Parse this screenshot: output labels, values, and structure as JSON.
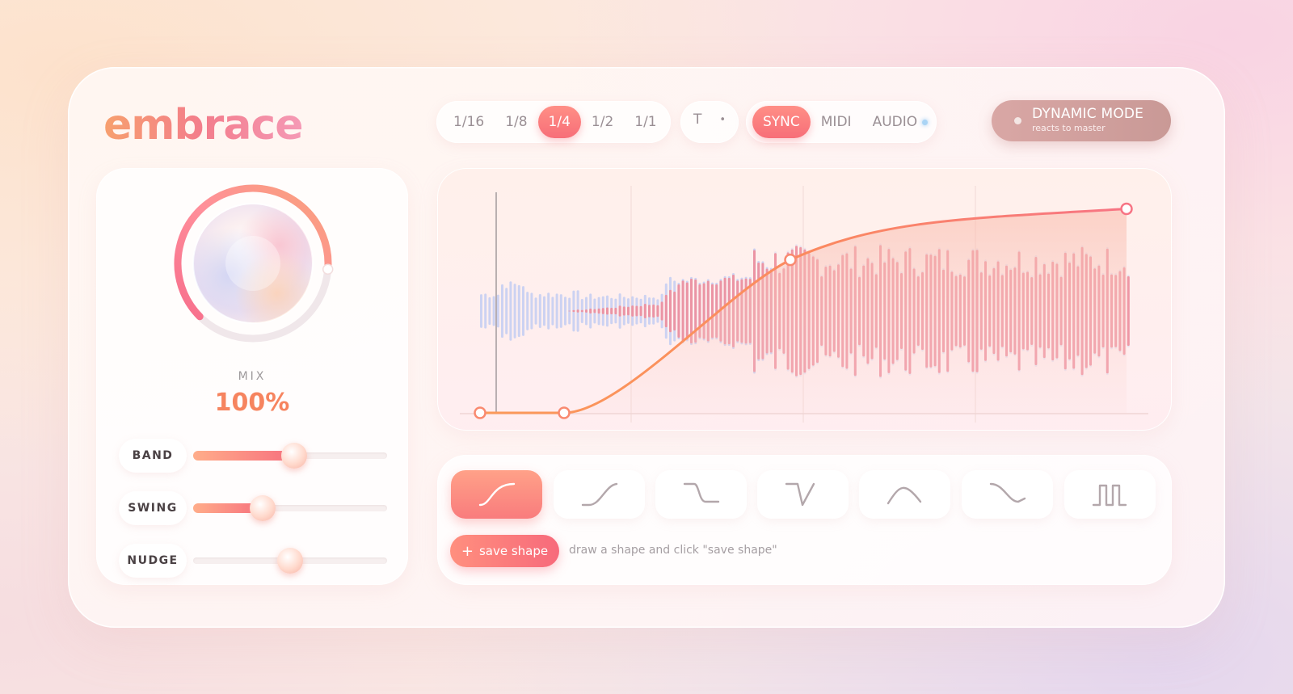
{
  "app": {
    "logo": "embrace"
  },
  "rate_selector": {
    "options": [
      "1/16",
      "1/8",
      "1/4",
      "1/2",
      "1/1"
    ],
    "selected": "1/4"
  },
  "mode_small": {
    "t_label": "T",
    "dot_label": "•"
  },
  "sync_selector": {
    "options": [
      "SYNC",
      "MIDI",
      "AUDIO"
    ],
    "selected": "SYNC"
  },
  "dynamic_mode": {
    "title": "DYNAMIC MODE",
    "subtitle": "reacts to master"
  },
  "mix": {
    "label": "MIX",
    "value": "100%",
    "level": 0.85
  },
  "sliders": [
    {
      "label": "BAND",
      "value": 0.52
    },
    {
      "label": "SWING",
      "value": 0.36
    },
    {
      "label": "NUDGE",
      "value": 0.5
    }
  ],
  "shapes": [
    "s-curve",
    "ramp-up",
    "step-down",
    "v-dip",
    "peak",
    "ease-down",
    "pulse"
  ],
  "selected_shape": 0,
  "save_shape": {
    "label": "save shape",
    "plus": "+"
  },
  "hint": "draw a shape and click \"save shape\"",
  "colors": {
    "accent": "#f76e78",
    "accent_orange": "#f6845f",
    "wave_blue": "#c3cdf2",
    "wave_pink": "#f08a97"
  },
  "envelope": {
    "points": [
      [
        0,
        0
      ],
      [
        0.13,
        0
      ],
      [
        0.48,
        0.72
      ],
      [
        1,
        0.96
      ]
    ]
  }
}
